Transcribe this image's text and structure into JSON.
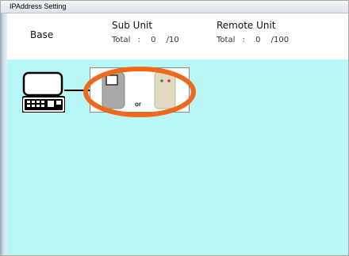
{
  "window": {
    "title": "IPAddress Setting"
  },
  "header": {
    "base_label": "Base",
    "sub_unit": {
      "label": "Sub Unit",
      "total_label": "Total",
      "separator": ":",
      "count": "0",
      "max": "/10"
    },
    "remote_unit": {
      "label": "Remote Unit",
      "total_label": "Total",
      "separator": ":",
      "count": "0",
      "max": "/100"
    }
  },
  "canvas": {
    "background_color": "#b9f6f6",
    "sub_unit_choice_text": "or",
    "highlight_color": "#ee6a1a",
    "devices": {
      "base_icon": "base-controller-icon",
      "sub_unit_option_1_icon": "gray-sub-unit-icon",
      "sub_unit_option_2_icon": "beige-sub-unit-icon"
    }
  }
}
